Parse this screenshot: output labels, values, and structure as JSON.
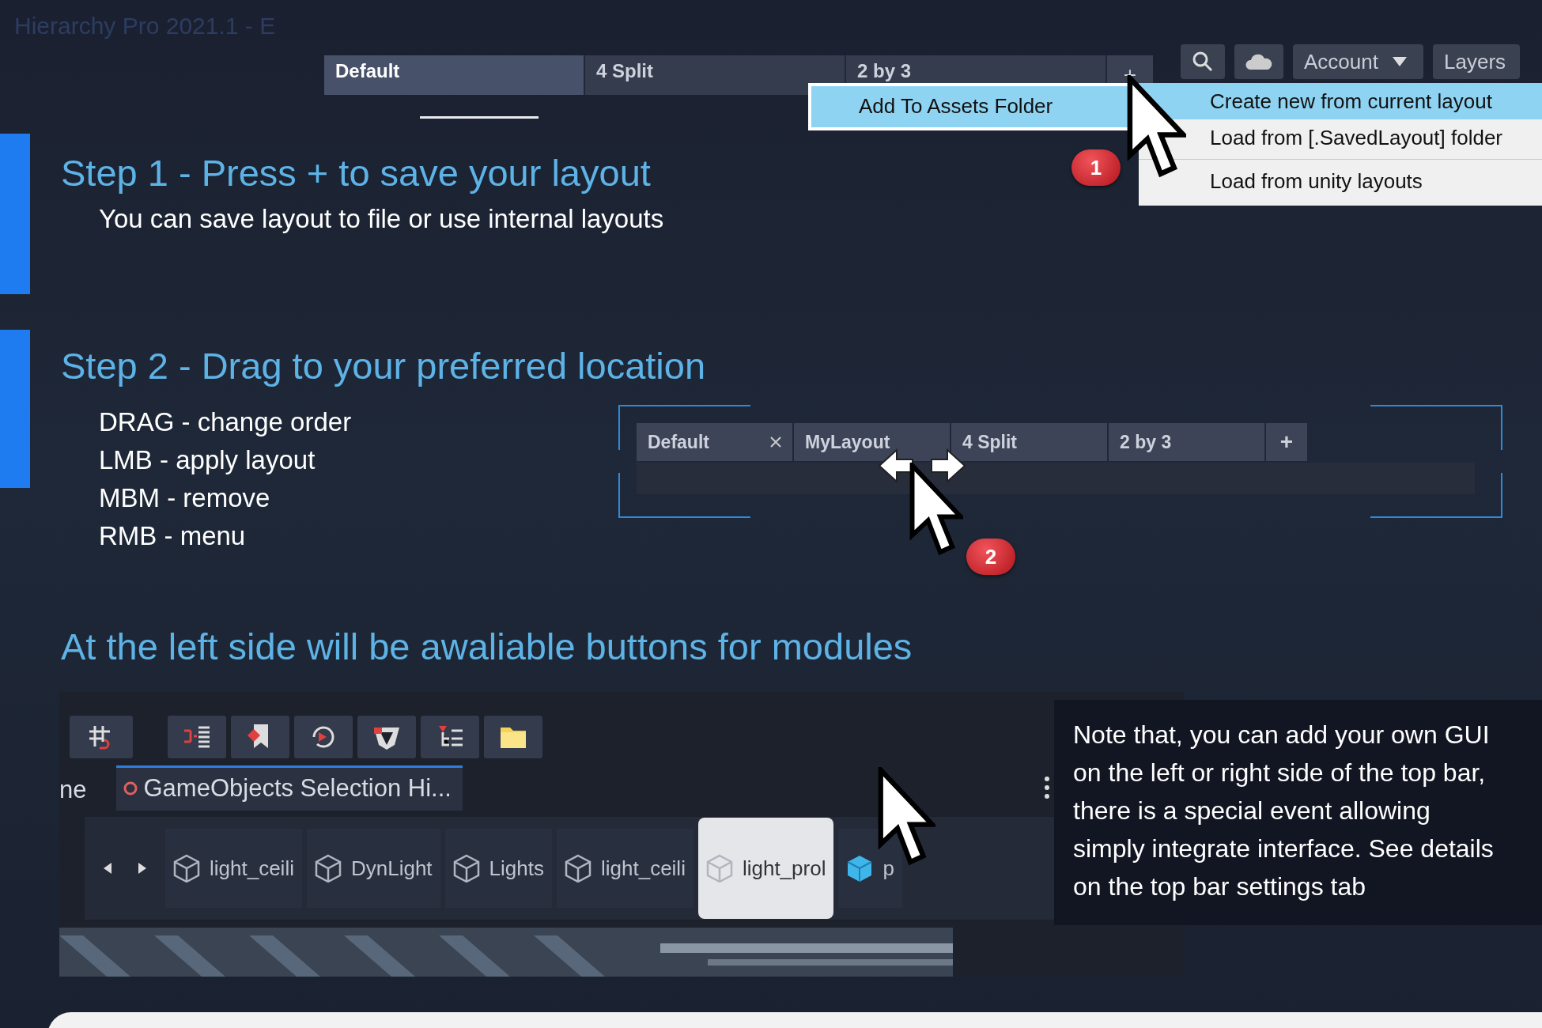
{
  "window": {
    "title": "Hierarchy Pro 2021.1 - E"
  },
  "top_bar": {
    "tabs": [
      {
        "label": "Default",
        "selected": true
      },
      {
        "label": "4 Split",
        "selected": false
      },
      {
        "label": "2 by 3",
        "selected": false
      }
    ],
    "add_button": "+",
    "account": "Account",
    "layers": "Layers"
  },
  "layout_menu": {
    "submenu": [
      {
        "label": "Add To Assets Folder",
        "selected": true
      }
    ],
    "items": [
      {
        "label": "Create new from current layout",
        "selected": true,
        "separator_before": false
      },
      {
        "label": "Load from [.SavedLayout] folder",
        "selected": false,
        "separator_before": false
      },
      {
        "label": "Load from unity layouts",
        "selected": false,
        "separator_before": true
      }
    ]
  },
  "markers": [
    "1",
    "2"
  ],
  "step1": {
    "heading": "Step 1 - Press + to save your layout",
    "text": "You can save layout to file or use internal layouts"
  },
  "step2": {
    "heading": "Step 2 - Drag to your preferred location",
    "lines": [
      "DRAG - change order",
      "LMB - apply layout",
      "MBM - remove",
      "RMB - menu"
    ]
  },
  "demo_bar": {
    "tabs": [
      {
        "label": "Default",
        "closable": true
      },
      {
        "label": "MyLayout",
        "closable": false
      },
      {
        "label": "4 Split",
        "closable": false
      },
      {
        "label": "2 by 3",
        "closable": false
      }
    ],
    "add_button": "+"
  },
  "modules_heading": "At the left side will be awaliable buttons for modules",
  "hierarchy_panel": {
    "tabs": [
      {
        "label": "ne",
        "selected": false
      },
      {
        "label": "GameObjects Selection Hi...",
        "selected": true
      }
    ],
    "items": [
      {
        "label": "light_ceili",
        "kind": "object",
        "selected": false
      },
      {
        "label": "DynLight",
        "kind": "object",
        "selected": false
      },
      {
        "label": "Lights",
        "kind": "object",
        "selected": false
      },
      {
        "label": "light_ceili",
        "kind": "object",
        "selected": false
      },
      {
        "label": "light_prol",
        "kind": "object",
        "selected": true
      },
      {
        "label": "p",
        "kind": "prefab",
        "selected": false
      }
    ]
  },
  "note": "Note that, you can add your own GUI on the left or right side of the top bar, there is a special event allowing simply integrate interface. See details on the top bar settings tab"
}
